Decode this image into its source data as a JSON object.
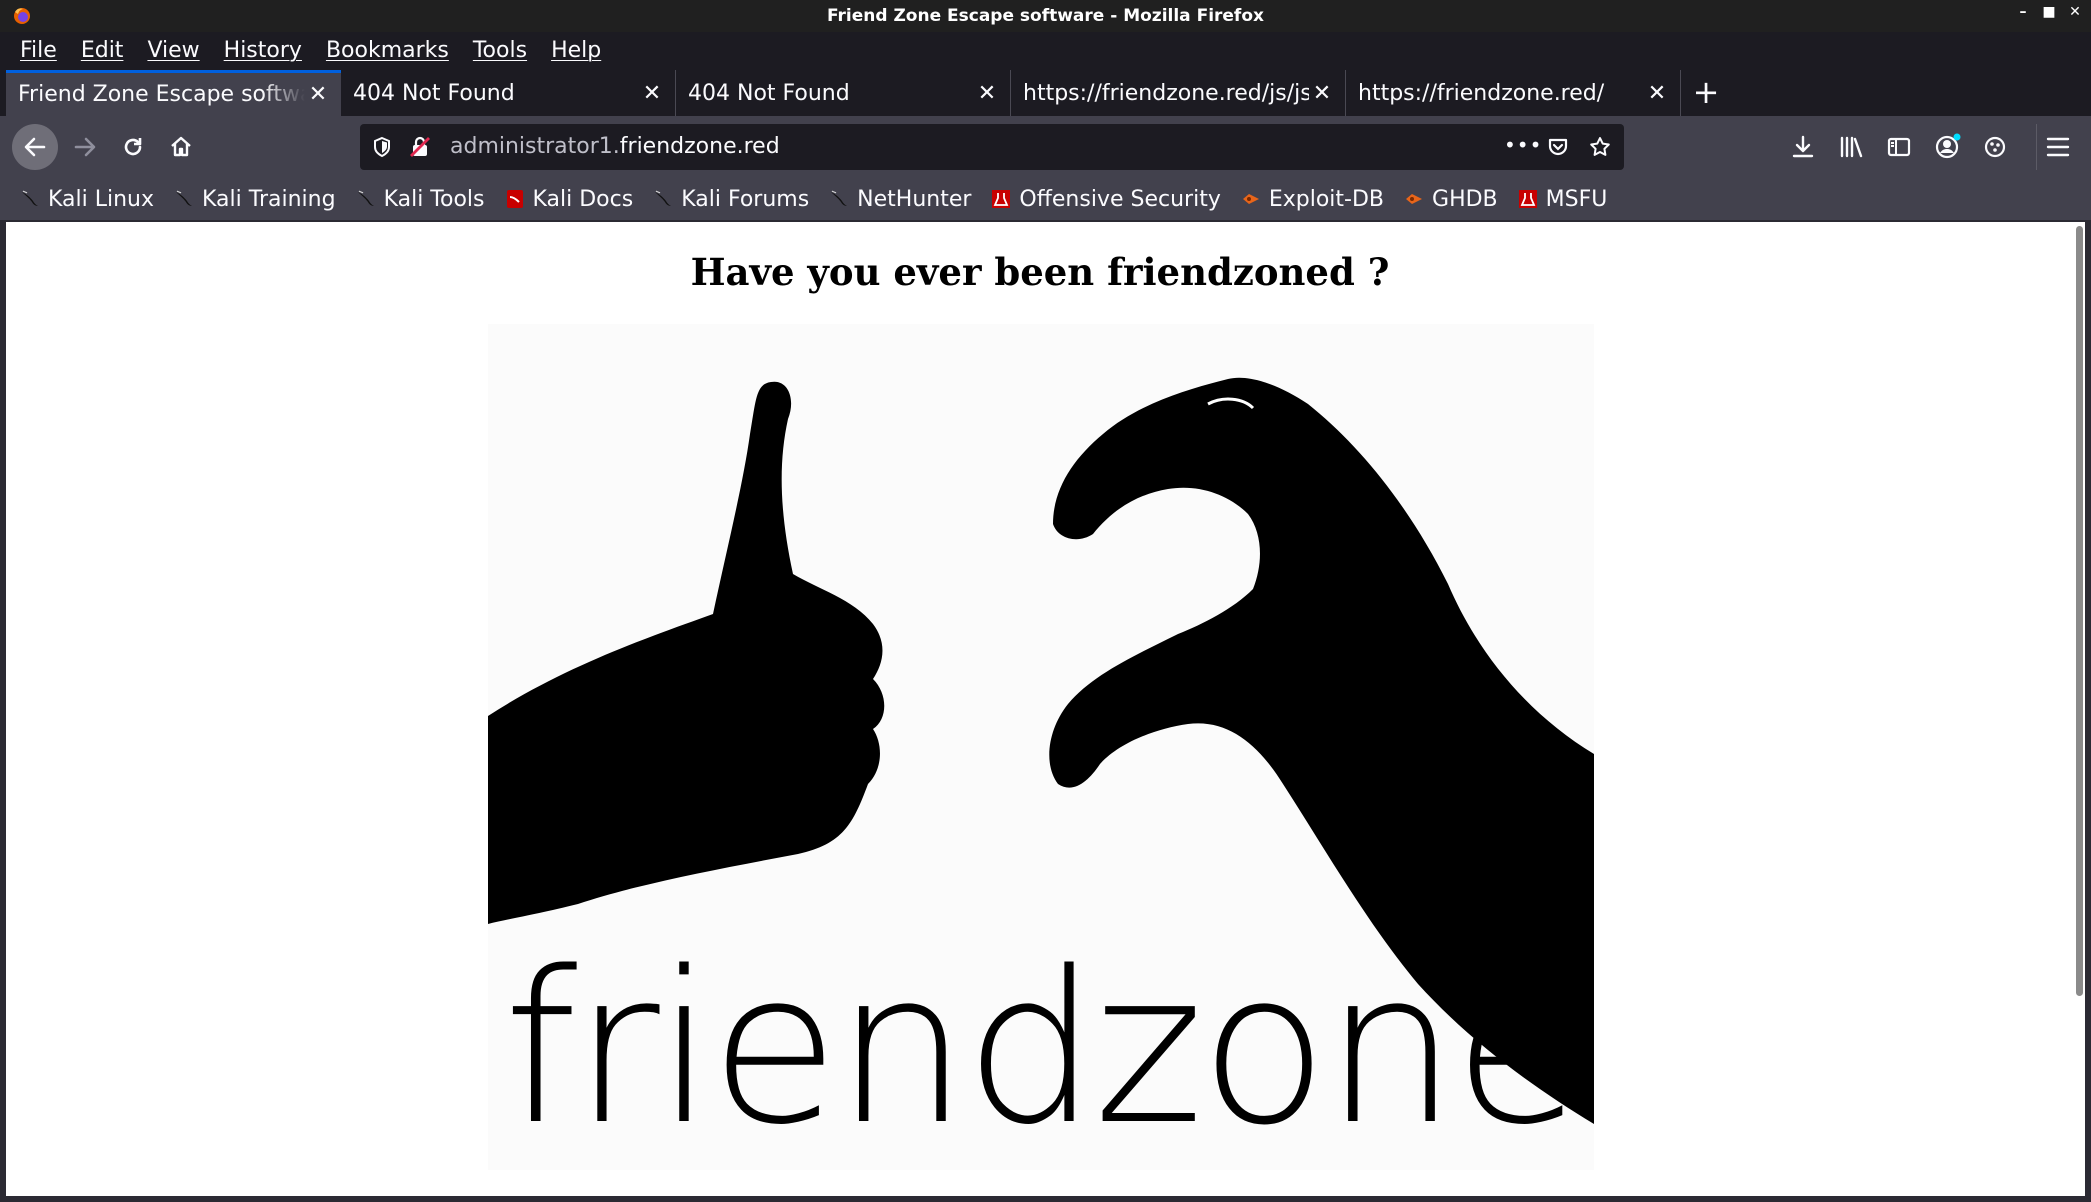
{
  "window": {
    "title": "Friend Zone Escape software - Mozilla Firefox",
    "controls": {
      "minimize": "–",
      "maximize": "■",
      "close": "✕"
    }
  },
  "menu": [
    "File",
    "Edit",
    "View",
    "History",
    "Bookmarks",
    "Tools",
    "Help"
  ],
  "tabs": [
    {
      "title": "Friend Zone Escape software",
      "active": true
    },
    {
      "title": "404 Not Found",
      "active": false
    },
    {
      "title": "404 Not Found",
      "active": false
    },
    {
      "title": "https://friendzone.red/js/js/",
      "active": false
    },
    {
      "title": "https://friendzone.red/",
      "active": false
    }
  ],
  "tab_close_glyph": "✕",
  "new_tab_glyph": "+",
  "url": {
    "subdomain": "administrator1.",
    "domain": "friendzone.red"
  },
  "page_actions_glyph": "•••",
  "bookmarks": [
    {
      "label": "Kali Linux",
      "icon": "kali-dragon-icon"
    },
    {
      "label": "Kali Training",
      "icon": "kali-dragon-icon"
    },
    {
      "label": "Kali Tools",
      "icon": "kali-dragon-icon"
    },
    {
      "label": "Kali Docs",
      "icon": "kali-docs-icon"
    },
    {
      "label": "Kali Forums",
      "icon": "kali-dragon-icon"
    },
    {
      "label": "NetHunter",
      "icon": "kali-dragon-icon"
    },
    {
      "label": "Offensive Security",
      "icon": "offsec-icon"
    },
    {
      "label": "Exploit-DB",
      "icon": "exploitdb-icon"
    },
    {
      "label": "GHDB",
      "icon": "exploitdb-icon"
    },
    {
      "label": "MSFU",
      "icon": "offsec-icon"
    }
  ],
  "page": {
    "heading": "Have you ever been friendzoned ?",
    "image_logo_text": "friendzone"
  },
  "colors": {
    "accent": "#0060df",
    "toolbar": "#42414d",
    "tabstrip": "#1c1b22",
    "offsec_red": "#c80000",
    "exploitdb_orange": "#e8651a"
  }
}
